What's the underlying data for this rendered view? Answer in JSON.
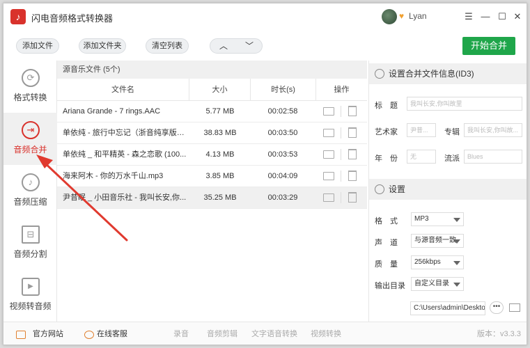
{
  "app": {
    "title": "闪电音频格式转换器",
    "user_name": "Lyan",
    "user_badge": "♥"
  },
  "window_controls": {
    "menu": "☰",
    "minimize": "—",
    "maximize": "☐",
    "close": "✕"
  },
  "toolbar": {
    "add_file": "添加文件",
    "add_folder": "添加文件夹",
    "clear_list": "清空列表",
    "move_up": "︿",
    "move_down": "﹀",
    "start_merge": "开始合并"
  },
  "sidebar": {
    "items": [
      {
        "label": "格式转换",
        "icon": "refresh-icon",
        "glyph": "⟳"
      },
      {
        "label": "音频合并",
        "icon": "merge-icon",
        "glyph": "⇥"
      },
      {
        "label": "音频压缩",
        "icon": "music-note-icon",
        "glyph": "♪"
      },
      {
        "label": "音频分割",
        "icon": "split-icon",
        "glyph": "⊟"
      },
      {
        "label": "视频转音频",
        "icon": "video-play-icon",
        "glyph": "▶"
      }
    ]
  },
  "files": {
    "header": "源音乐文件 (5个)",
    "columns": {
      "name": "文件名",
      "size": "大小",
      "duration": "时长(s)",
      "ops": "操作"
    },
    "rows": [
      {
        "name": "Ariana Grande - 7 rings.AAC",
        "size": "5.77 MB",
        "duration": "00:02:58"
      },
      {
        "name": "单依纯 - 旅行中忘记（浙音纯享版）...",
        "size": "38.83 MB",
        "duration": "00:03:50"
      },
      {
        "name": "单依纯 _ 和平精英 - 森之恋歌 (100...",
        "size": "4.13 MB",
        "duration": "00:03:53"
      },
      {
        "name": "海来阿木 - 你的万水千山.mp3",
        "size": "3.85 MB",
        "duration": "00:04:09"
      },
      {
        "name": "尹昔眠 _ 小田音乐社 - 我叫长安,你...",
        "size": "35.25 MB",
        "duration": "00:03:29"
      }
    ]
  },
  "id3": {
    "section_title": "设置合并文件信息(ID3)",
    "title_label": "标　题",
    "title_placeholder": "我叫长安,你叫故里",
    "artist_label": "艺术家",
    "artist_placeholder": "尹昔...",
    "album_label": "专辑",
    "album_placeholder": "我叫长安,你叫故...",
    "year_label": "年　份",
    "year_placeholder": "无",
    "genre_label": "流派",
    "genre_placeholder": "Blues"
  },
  "settings": {
    "section_title": "设置",
    "format_label": "格　式",
    "format_value": "MP3",
    "channel_label": "声　道",
    "channel_value": "与源音频一致",
    "quality_label": "质　量",
    "quality_value": "256kbps",
    "output_label": "输出目录",
    "output_value": "自定义目录",
    "path_value": "C:\\Users\\admin\\Desktop",
    "dots": "•••"
  },
  "footer": {
    "website": "官方网站",
    "service": "在线客服",
    "record": "录音",
    "edit": "音频剪辑",
    "tts": "文字语音转换",
    "video": "视频转换",
    "version": "版本：v3.3.3"
  },
  "colors": {
    "accent_red": "#d9322c",
    "start_green": "#1fa64a"
  }
}
